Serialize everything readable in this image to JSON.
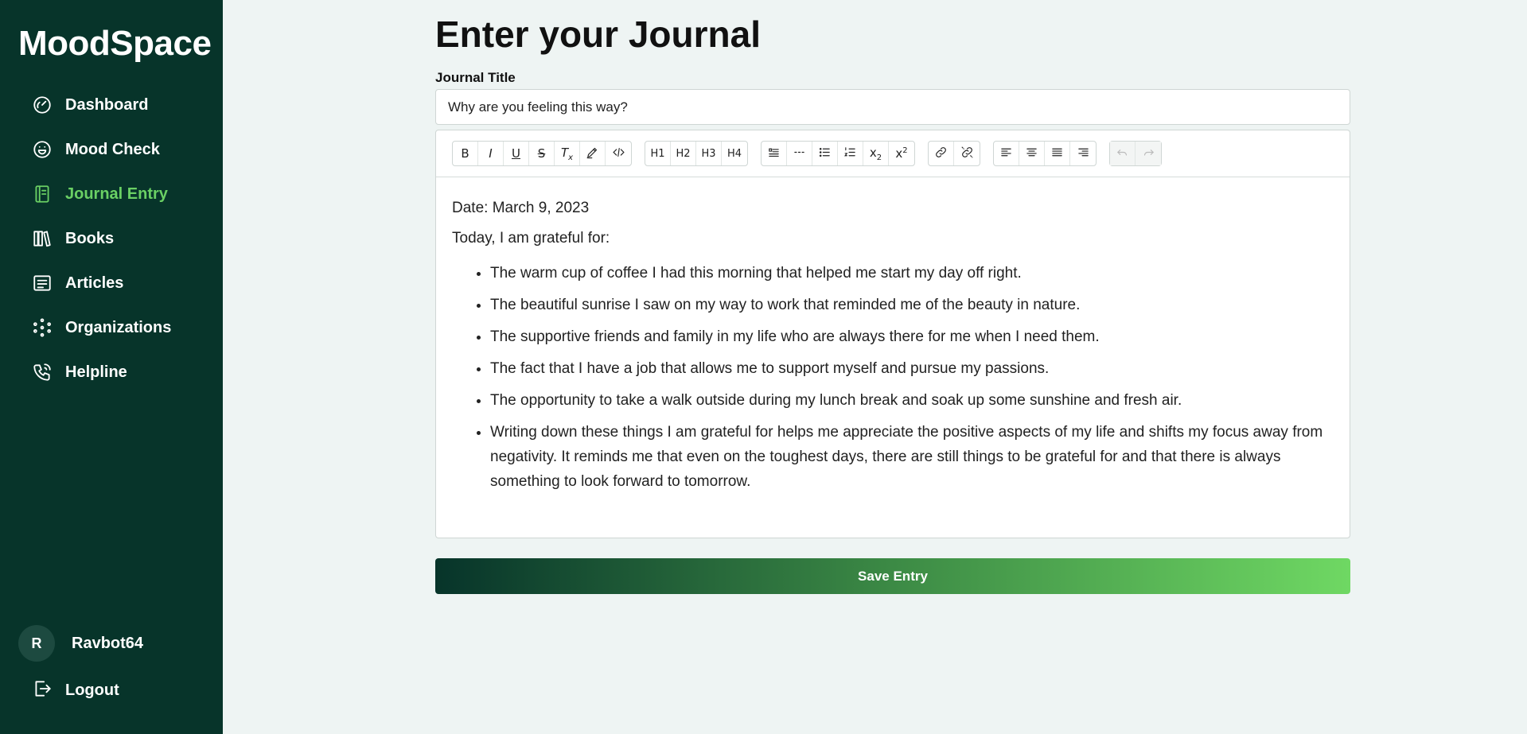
{
  "app": {
    "brand": "MoodSpace"
  },
  "sidebar": {
    "items": [
      {
        "label": "Dashboard",
        "icon": "gauge-icon",
        "active": false
      },
      {
        "label": "Mood Check",
        "icon": "smiley-icon",
        "active": false
      },
      {
        "label": "Journal Entry",
        "icon": "journal-icon",
        "active": true
      },
      {
        "label": "Books",
        "icon": "books-icon",
        "active": false
      },
      {
        "label": "Articles",
        "icon": "article-icon",
        "active": false
      },
      {
        "label": "Organizations",
        "icon": "organization-icon",
        "active": false
      },
      {
        "label": "Helpline",
        "icon": "phone-icon",
        "active": false
      }
    ],
    "user": {
      "initial": "R",
      "name": "Ravbot64"
    },
    "logout_label": "Logout"
  },
  "main": {
    "page_title": "Enter your Journal",
    "title_label": "Journal Title",
    "title_placeholder": "Why are you feeling this way?",
    "toolbar": {
      "heading_labels": [
        "H1",
        "H2",
        "H3",
        "H4"
      ]
    },
    "editor": {
      "date_line": "Date: March 9, 2023",
      "intro_line": "Today, I am grateful for:",
      "items": [
        "The warm cup of coffee I had this morning that helped me start my day off right.",
        "The beautiful sunrise I saw on my way to work that reminded me of the beauty in nature.",
        "The supportive friends and family in my life who are always there for me when I need them.",
        "The fact that I have a job that allows me to support myself and pursue my passions.",
        "The opportunity to take a walk outside during my lunch break and soak up some sunshine and fresh air.",
        "Writing down these things I am grateful for helps me appreciate the positive aspects of my life and shifts my focus away from negativity. It reminds me that even on the toughest days, there are still things to be grateful for and that there is always something to look forward to tomorrow."
      ]
    },
    "save_label": "Save Entry"
  },
  "colors": {
    "sidebar_bg": "#07342a",
    "accent": "#6ad064",
    "page_bg": "#eef4f3"
  }
}
